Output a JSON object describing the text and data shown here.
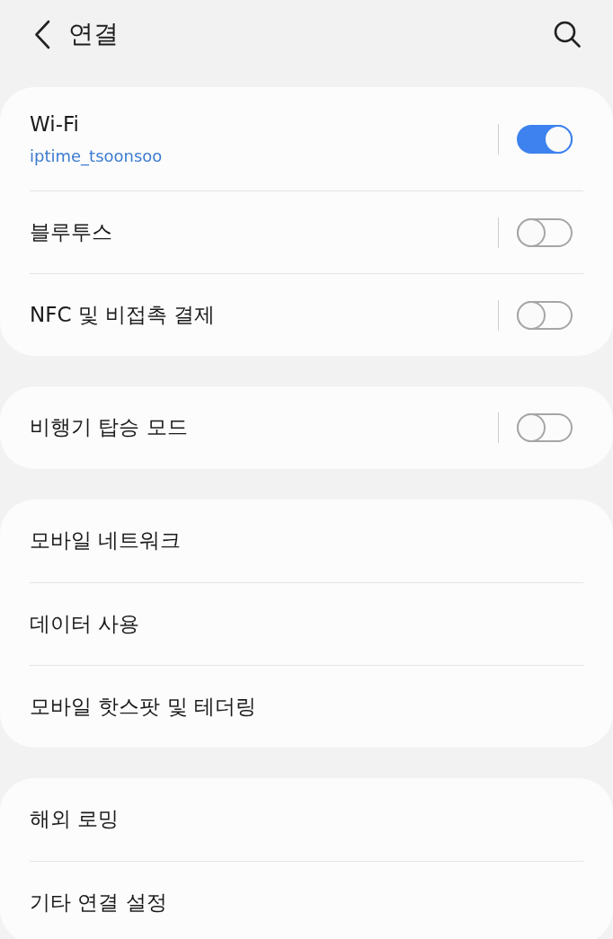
{
  "header": {
    "title": "연결"
  },
  "groups": [
    {
      "items": [
        {
          "kind": "toggle",
          "label": "Wi-Fi",
          "summary": "iptime_tsoonsoo",
          "on": true
        },
        {
          "kind": "toggle",
          "label": "블루투스",
          "on": false
        },
        {
          "kind": "toggle",
          "label": "NFC 및 비접촉 결제",
          "on": false
        }
      ]
    },
    {
      "items": [
        {
          "kind": "toggle",
          "label": "비행기 탑승 모드",
          "on": false
        }
      ]
    },
    {
      "items": [
        {
          "kind": "link",
          "label": "모바일 네트워크"
        },
        {
          "kind": "link",
          "label": "데이터 사용"
        },
        {
          "kind": "link",
          "label": "모바일 핫스팟 및 테더링"
        }
      ]
    },
    {
      "items": [
        {
          "kind": "link",
          "label": "해외 로밍"
        },
        {
          "kind": "link",
          "label": "기타 연결 설정"
        }
      ]
    }
  ]
}
